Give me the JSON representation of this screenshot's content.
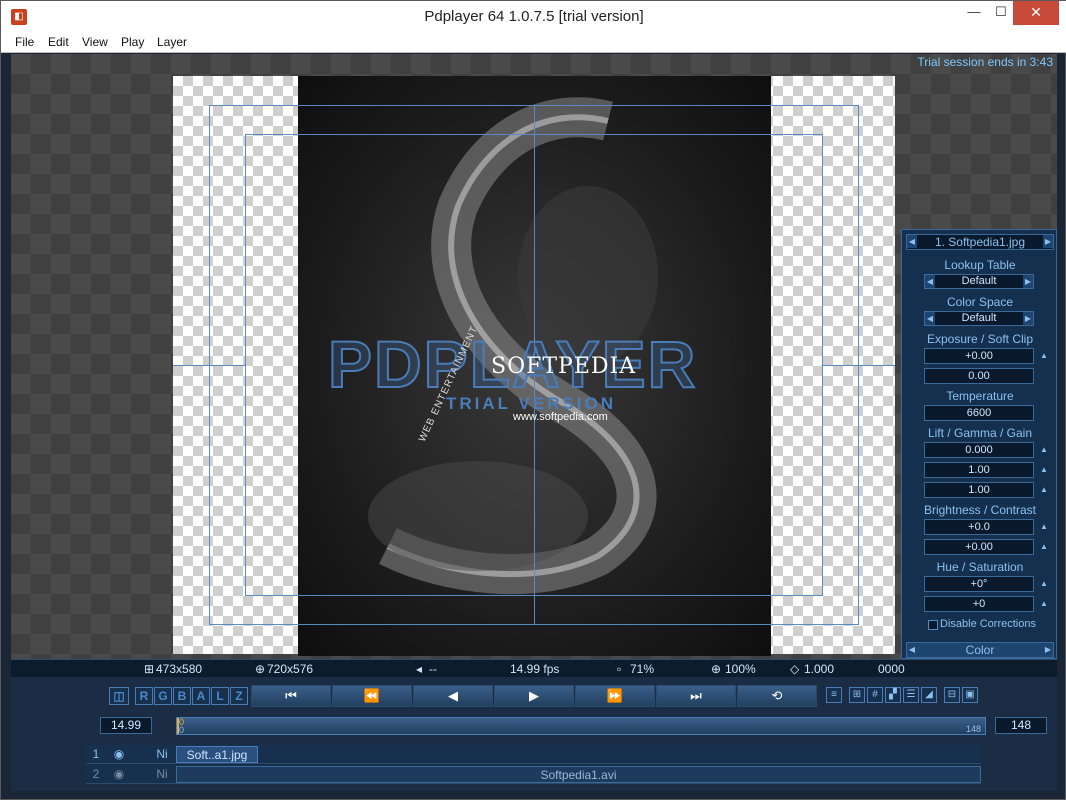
{
  "window": {
    "title": "Pdplayer 64 1.0.7.5 [trial version]",
    "min": "—",
    "max": "☐",
    "close": "✕"
  },
  "menu": [
    "File",
    "Edit",
    "View",
    "Play",
    "Layer"
  ],
  "viewport": {
    "trial_session": "Trial session ends in 3:43",
    "watermark_brand": "PDPLAYER",
    "watermark_trial": "TRIAL VERSION",
    "image_logo": "SOFTPEDIA",
    "image_url": "www.softpedia.com",
    "image_tagline": "WEB ENTERTAINMENT"
  },
  "color_panel": {
    "file_name": "1. Softpedia1.jpg",
    "lookup_table_label": "Lookup Table",
    "lookup_table_value": "Default",
    "color_space_label": "Color Space",
    "color_space_value": "Default",
    "exposure_label": "Exposure / Soft Clip",
    "exposure_value": "+0.00",
    "soft_clip_value": "0.00",
    "temperature_label": "Temperature",
    "temperature_value": "6600",
    "lgg_label": "Lift / Gamma / Gain",
    "lift_value": "0.000",
    "gamma_value": "1.00",
    "gain_value": "1.00",
    "bc_label": "Brightness / Contrast",
    "brightness_value": "+0.0",
    "contrast_value": "+0.00",
    "hs_label": "Hue / Saturation",
    "hue_value": "+0°",
    "saturation_value": "+0",
    "disable_label": "Disable Corrections",
    "footer_label": "Color"
  },
  "status": {
    "image_size": "473x580",
    "canvas_size": "720x576",
    "audio": "--",
    "fps": "14.99 fps",
    "opacity": "71%",
    "zoom": "100%",
    "aspect": "1.000",
    "frame": "0000"
  },
  "channels": [
    "RGB",
    "A",
    "L",
    "Z"
  ],
  "channel_letters": [
    "R",
    "G",
    "B",
    "A",
    "L",
    "Z"
  ],
  "transport": {
    "first": "⏮",
    "prev_frame": "⏪",
    "play_back": "◀",
    "play": "▶",
    "next_frame": "⏩",
    "last": "⏭",
    "loop": "⟲"
  },
  "timeline": {
    "fps_value": "14.99",
    "start": "0",
    "start_top": "0",
    "end_label": "148",
    "end_value": "148"
  },
  "layers": [
    {
      "num": "1",
      "ni": "Ni",
      "clip": "Soft..a1.jpg"
    },
    {
      "num": "2",
      "ni": "Ni",
      "clip": "Softpedia1.avi"
    }
  ],
  "colors": {
    "accent": "#4a7cb8",
    "panel_bg": "#14304e",
    "text_blue": "#8cc0f0",
    "close_red": "#c74a3b"
  }
}
